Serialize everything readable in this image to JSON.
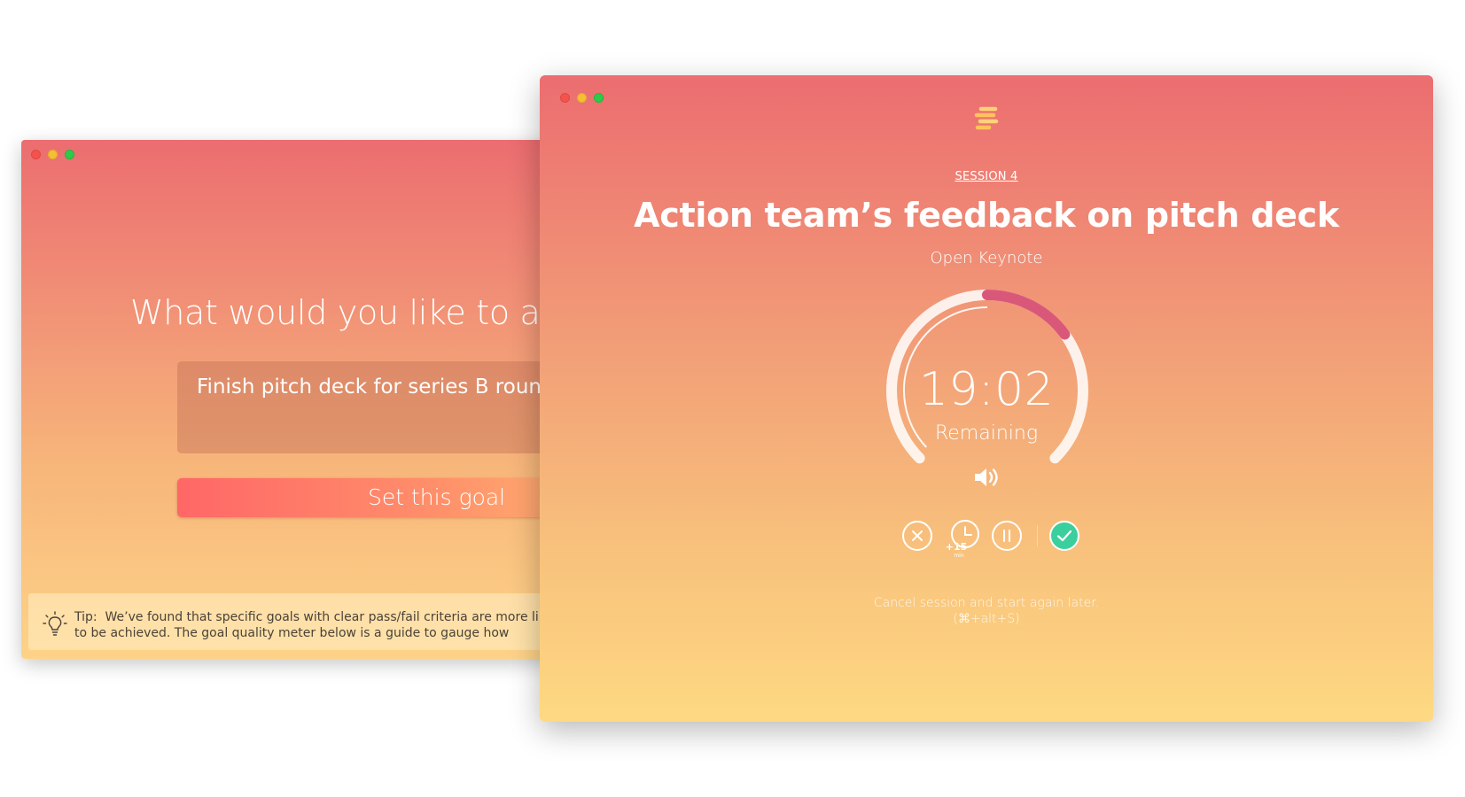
{
  "colors": {
    "close": "#f2544d",
    "minimize": "#f6be35",
    "zoom": "#2ecb48",
    "timer_progress": "#d9587a",
    "complete_button": "#3ccf9e"
  },
  "goal_window": {
    "heading": "What would you like to ach",
    "goal_input_value": "Finish pitch deck for series B round",
    "set_goal_button": "Set this goal",
    "tip": {
      "icon": "lightbulb-icon",
      "label": "Tip:",
      "text": "We’ve found that specific goals with clear pass/fail criteria are more likely to be achieved. The goal quality meter below is a guide to gauge how"
    }
  },
  "session_window": {
    "logo_icon": "stacked-bars-logo",
    "session_label": "SESSION 4",
    "title": "Action team’s feedback on pitch deck",
    "subtitle": "Open Keynote",
    "timer": {
      "time": "19:02",
      "caption": "Remaining",
      "progress_elapsed": 0.2
    },
    "controls": {
      "cancel_icon": "close-circle-icon",
      "extend_icon": "clock-icon",
      "extend_label": "+15",
      "extend_unit": "min",
      "pause_icon": "pause-icon",
      "complete_icon": "check-icon",
      "sound_icon": "speaker-icon"
    },
    "hint": {
      "line1": "Cancel session and start again later.",
      "line2": "(⌘+alt+S)"
    }
  }
}
